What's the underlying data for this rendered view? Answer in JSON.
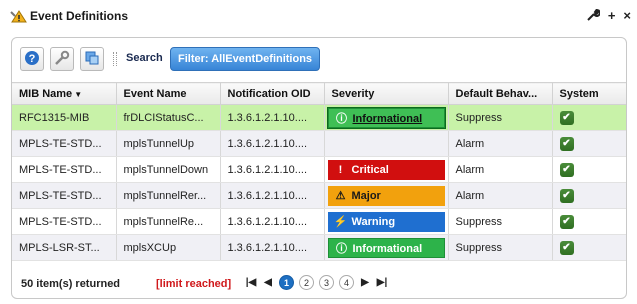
{
  "window": {
    "title": "Event Definitions",
    "icon": "event-definitions-icon",
    "actions": [
      {
        "name": "wrench-icon",
        "glyph": "⚒"
      },
      {
        "name": "add-icon",
        "glyph": "+"
      },
      {
        "name": "close-icon",
        "glyph": "×"
      }
    ]
  },
  "toolbar": {
    "help_icon": "help-icon",
    "settings_icon": "wrench-icon",
    "refresh_icon": "refresh-icon",
    "search_label": "Search",
    "filter_label": "Filter: AllEventDefinitions"
  },
  "table": {
    "columns": [
      "MIB Name",
      "Event Name",
      "Notification OID",
      "Severity",
      "Default Behav...",
      "System"
    ],
    "sort_column": "MIB Name",
    "rows": [
      {
        "mib": "RFC1315-MIB",
        "event": "frDLCIStatusC...",
        "oid": "1.3.6.1.2.1.10....",
        "severity": "Informational",
        "severity_level": "informational",
        "behavior": "Suppress",
        "system": true,
        "selected": true
      },
      {
        "mib": "MPLS-TE-STD...",
        "event": "mplsTunnelUp",
        "oid": "1.3.6.1.2.1.10....",
        "severity": "",
        "severity_level": "",
        "behavior": "Alarm",
        "system": true,
        "selected": false
      },
      {
        "mib": "MPLS-TE-STD...",
        "event": "mplsTunnelDown",
        "oid": "1.3.6.1.2.1.10....",
        "severity": "Critical",
        "severity_level": "critical",
        "behavior": "Alarm",
        "system": true,
        "selected": false
      },
      {
        "mib": "MPLS-TE-STD...",
        "event": "mplsTunnelRer...",
        "oid": "1.3.6.1.2.1.10....",
        "severity": "Major",
        "severity_level": "major",
        "behavior": "Alarm",
        "system": true,
        "selected": false
      },
      {
        "mib": "MPLS-TE-STD...",
        "event": "mplsTunnelRe...",
        "oid": "1.3.6.1.2.1.10....",
        "severity": "Warning",
        "severity_level": "warning",
        "behavior": "Suppress",
        "system": true,
        "selected": false
      },
      {
        "mib": "MPLS-LSR-ST...",
        "event": "mplsXCUp",
        "oid": "1.3.6.1.2.1.10....",
        "severity": "Informational",
        "severity_level": "informational",
        "behavior": "Suppress",
        "system": true,
        "selected": false
      }
    ]
  },
  "footer": {
    "items_returned": "50 item(s) returned",
    "limit_text": "[limit reached]",
    "pages": [
      "1",
      "2",
      "3",
      "4"
    ],
    "current_page": "1"
  },
  "colors": {
    "selected_row": "#c8f2a8",
    "informational": "#2db34a",
    "critical": "#d10f0f",
    "major": "#f2a10d",
    "warning": "#1f6fd0",
    "limit_text": "#d0181b",
    "filter_pill": "#3784d6"
  }
}
